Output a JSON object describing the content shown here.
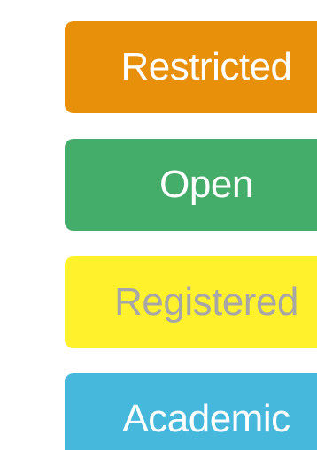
{
  "tiles": [
    {
      "label": "Restricted",
      "color": "#e8900a",
      "text_color": "#ffffff"
    },
    {
      "label": "Open",
      "color": "#45ad6a",
      "text_color": "#ffffff"
    },
    {
      "label": "Registered",
      "color": "#fff12b",
      "text_color": "#a6a6a6"
    },
    {
      "label": "Academic",
      "color": "#45b8dc",
      "text_color": "#ffffff"
    }
  ]
}
